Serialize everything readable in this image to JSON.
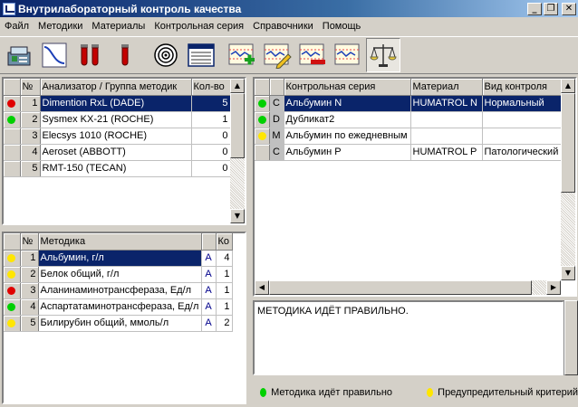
{
  "window": {
    "title": "Внутрилабораторный контроль качества",
    "minimize_glyph": "_",
    "maximize_glyph": "❐",
    "close_glyph": "✕"
  },
  "menu": [
    "Файл",
    "Методики",
    "Материалы",
    "Контрольная серия",
    "Справочники",
    "Помощь"
  ],
  "toolbar": {
    "buttons": [
      {
        "icon": "analyzer-icon"
      },
      {
        "icon": "sigmoid-curve-icon"
      },
      {
        "icon": "test-tubes-icon"
      },
      {
        "icon": "test-tube-icon"
      },
      {
        "icon": "target-icon"
      },
      {
        "icon": "journal-table-icon"
      },
      {
        "icon": "chart-add-icon"
      },
      {
        "icon": "chart-edit-icon"
      },
      {
        "icon": "chart-delete-icon"
      },
      {
        "icon": "chart-view-icon"
      },
      {
        "icon": "scales-icon",
        "pressed": true
      }
    ]
  },
  "analyzers": {
    "headers": [
      "",
      "№",
      "Анализатор / Группа методик",
      "Кол-во"
    ],
    "rows": [
      {
        "status": "red",
        "num": "1",
        "name": "Dimention RxL (DADE)",
        "count": "5",
        "selected": true
      },
      {
        "status": "green",
        "num": "2",
        "name": "Sysmex KX-21 (ROCHE)",
        "count": "1"
      },
      {
        "status": "",
        "num": "3",
        "name": "Elecsys 1010 (ROCHE)",
        "count": "0"
      },
      {
        "status": "",
        "num": "4",
        "name": "Aeroset (ABBOTT)",
        "count": "0"
      },
      {
        "status": "",
        "num": "5",
        "name": "RMT-150 (TECAN)",
        "count": "0"
      }
    ]
  },
  "methods": {
    "headers": [
      "",
      "№",
      "Методика",
      "",
      "Ко"
    ],
    "rows": [
      {
        "status": "yellow",
        "num": "1",
        "name": "Альбумин, г/л",
        "code": "A",
        "count": "4",
        "selected": true
      },
      {
        "status": "yellow",
        "num": "2",
        "name": "Белок общий, г/л",
        "code": "A",
        "count": "1"
      },
      {
        "status": "red",
        "num": "3",
        "name": "Аланинаминотрансфераза, Ед/л",
        "code": "A",
        "count": "1"
      },
      {
        "status": "green",
        "num": "4",
        "name": "Аспартатаминотрансфераза, Ед/л",
        "code": "A",
        "count": "1"
      },
      {
        "status": "yellow",
        "num": "5",
        "name": "Билирубин общий, ммоль/л",
        "code": "A",
        "count": "2"
      }
    ]
  },
  "series": {
    "headers": [
      "",
      "",
      "Контрольная серия",
      "Материал",
      "Вид контроля"
    ],
    "rows": [
      {
        "status": "green",
        "type": "C",
        "name": "Альбумин N",
        "material": "HUMATROL N",
        "kind": "Нормальный",
        "selected": true
      },
      {
        "status": "green",
        "type": "D",
        "name": "Дубликат2",
        "material": "",
        "kind": ""
      },
      {
        "status": "yellow",
        "type": "M",
        "name": "Альбумин по ежедневным",
        "material": "",
        "kind": ""
      },
      {
        "status": "",
        "type": "C",
        "name": "Альбумин P",
        "material": "HUMATROL P",
        "kind": "Патологический"
      }
    ]
  },
  "status_message": "МЕТОДИКА ИДЁТ ПРАВИЛЬНО.",
  "legend": [
    {
      "color": "green",
      "label": "Методика идёт правильно"
    },
    {
      "color": "yellow",
      "label": "Предупредительный критерий"
    }
  ],
  "scroll": {
    "up": "▲",
    "down": "▼",
    "left": "◀",
    "right": "▶"
  }
}
